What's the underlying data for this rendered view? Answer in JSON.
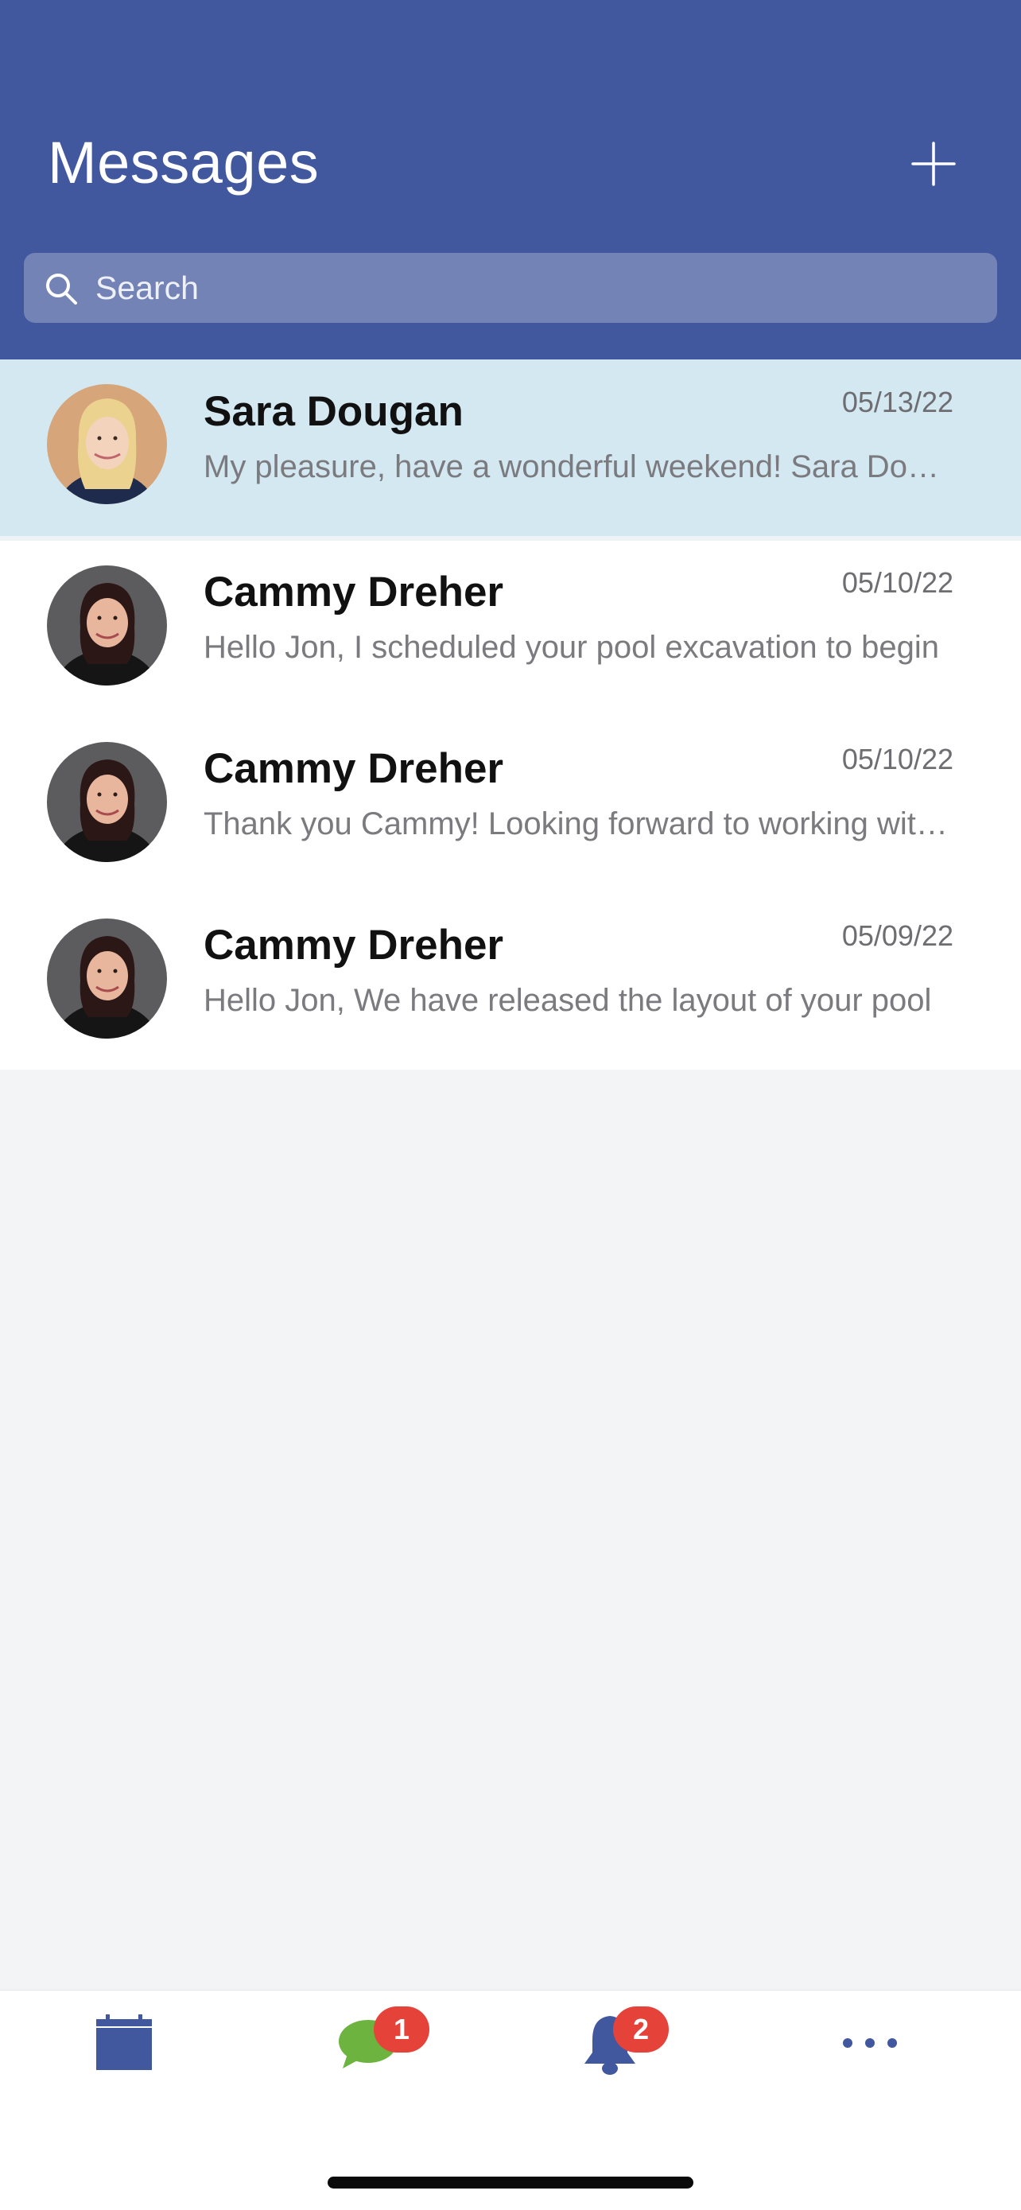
{
  "header": {
    "title": "Messages",
    "add_icon": "plus-icon",
    "background": "#41589f"
  },
  "search": {
    "placeholder": "Search",
    "icon": "search-icon"
  },
  "messages": [
    {
      "name": "Sara Dougan",
      "date": "05/13/22",
      "preview": "My pleasure, have a wonderful weekend!   Sara Dougan",
      "selected": true
    },
    {
      "name": "Cammy Dreher",
      "date": "05/10/22",
      "preview": "Hello Jon,  I scheduled your pool excavation to begin",
      "selected": false
    },
    {
      "name": "Cammy Dreher",
      "date": "05/10/22",
      "preview": "Thank you Cammy! Looking forward to working with you",
      "selected": false
    },
    {
      "name": "Cammy Dreher",
      "date": "05/09/22",
      "preview": "Hello Jon, We have released the layout of your pool",
      "selected": false
    }
  ],
  "tab_bar": {
    "tabs": [
      {
        "name": "calendar",
        "icon": "calendar-icon",
        "badge": ""
      },
      {
        "name": "messages",
        "icon": "chat-bubble-icon",
        "badge": "1"
      },
      {
        "name": "notifications",
        "icon": "bell-icon",
        "badge": "2"
      },
      {
        "name": "more",
        "icon": "more-dots-icon",
        "badge": ""
      }
    ]
  },
  "colors": {
    "accent": "#41589f",
    "selected_row": "#d3e8f1",
    "badge": "#e5433a",
    "chat_green": "#6cb33f"
  }
}
